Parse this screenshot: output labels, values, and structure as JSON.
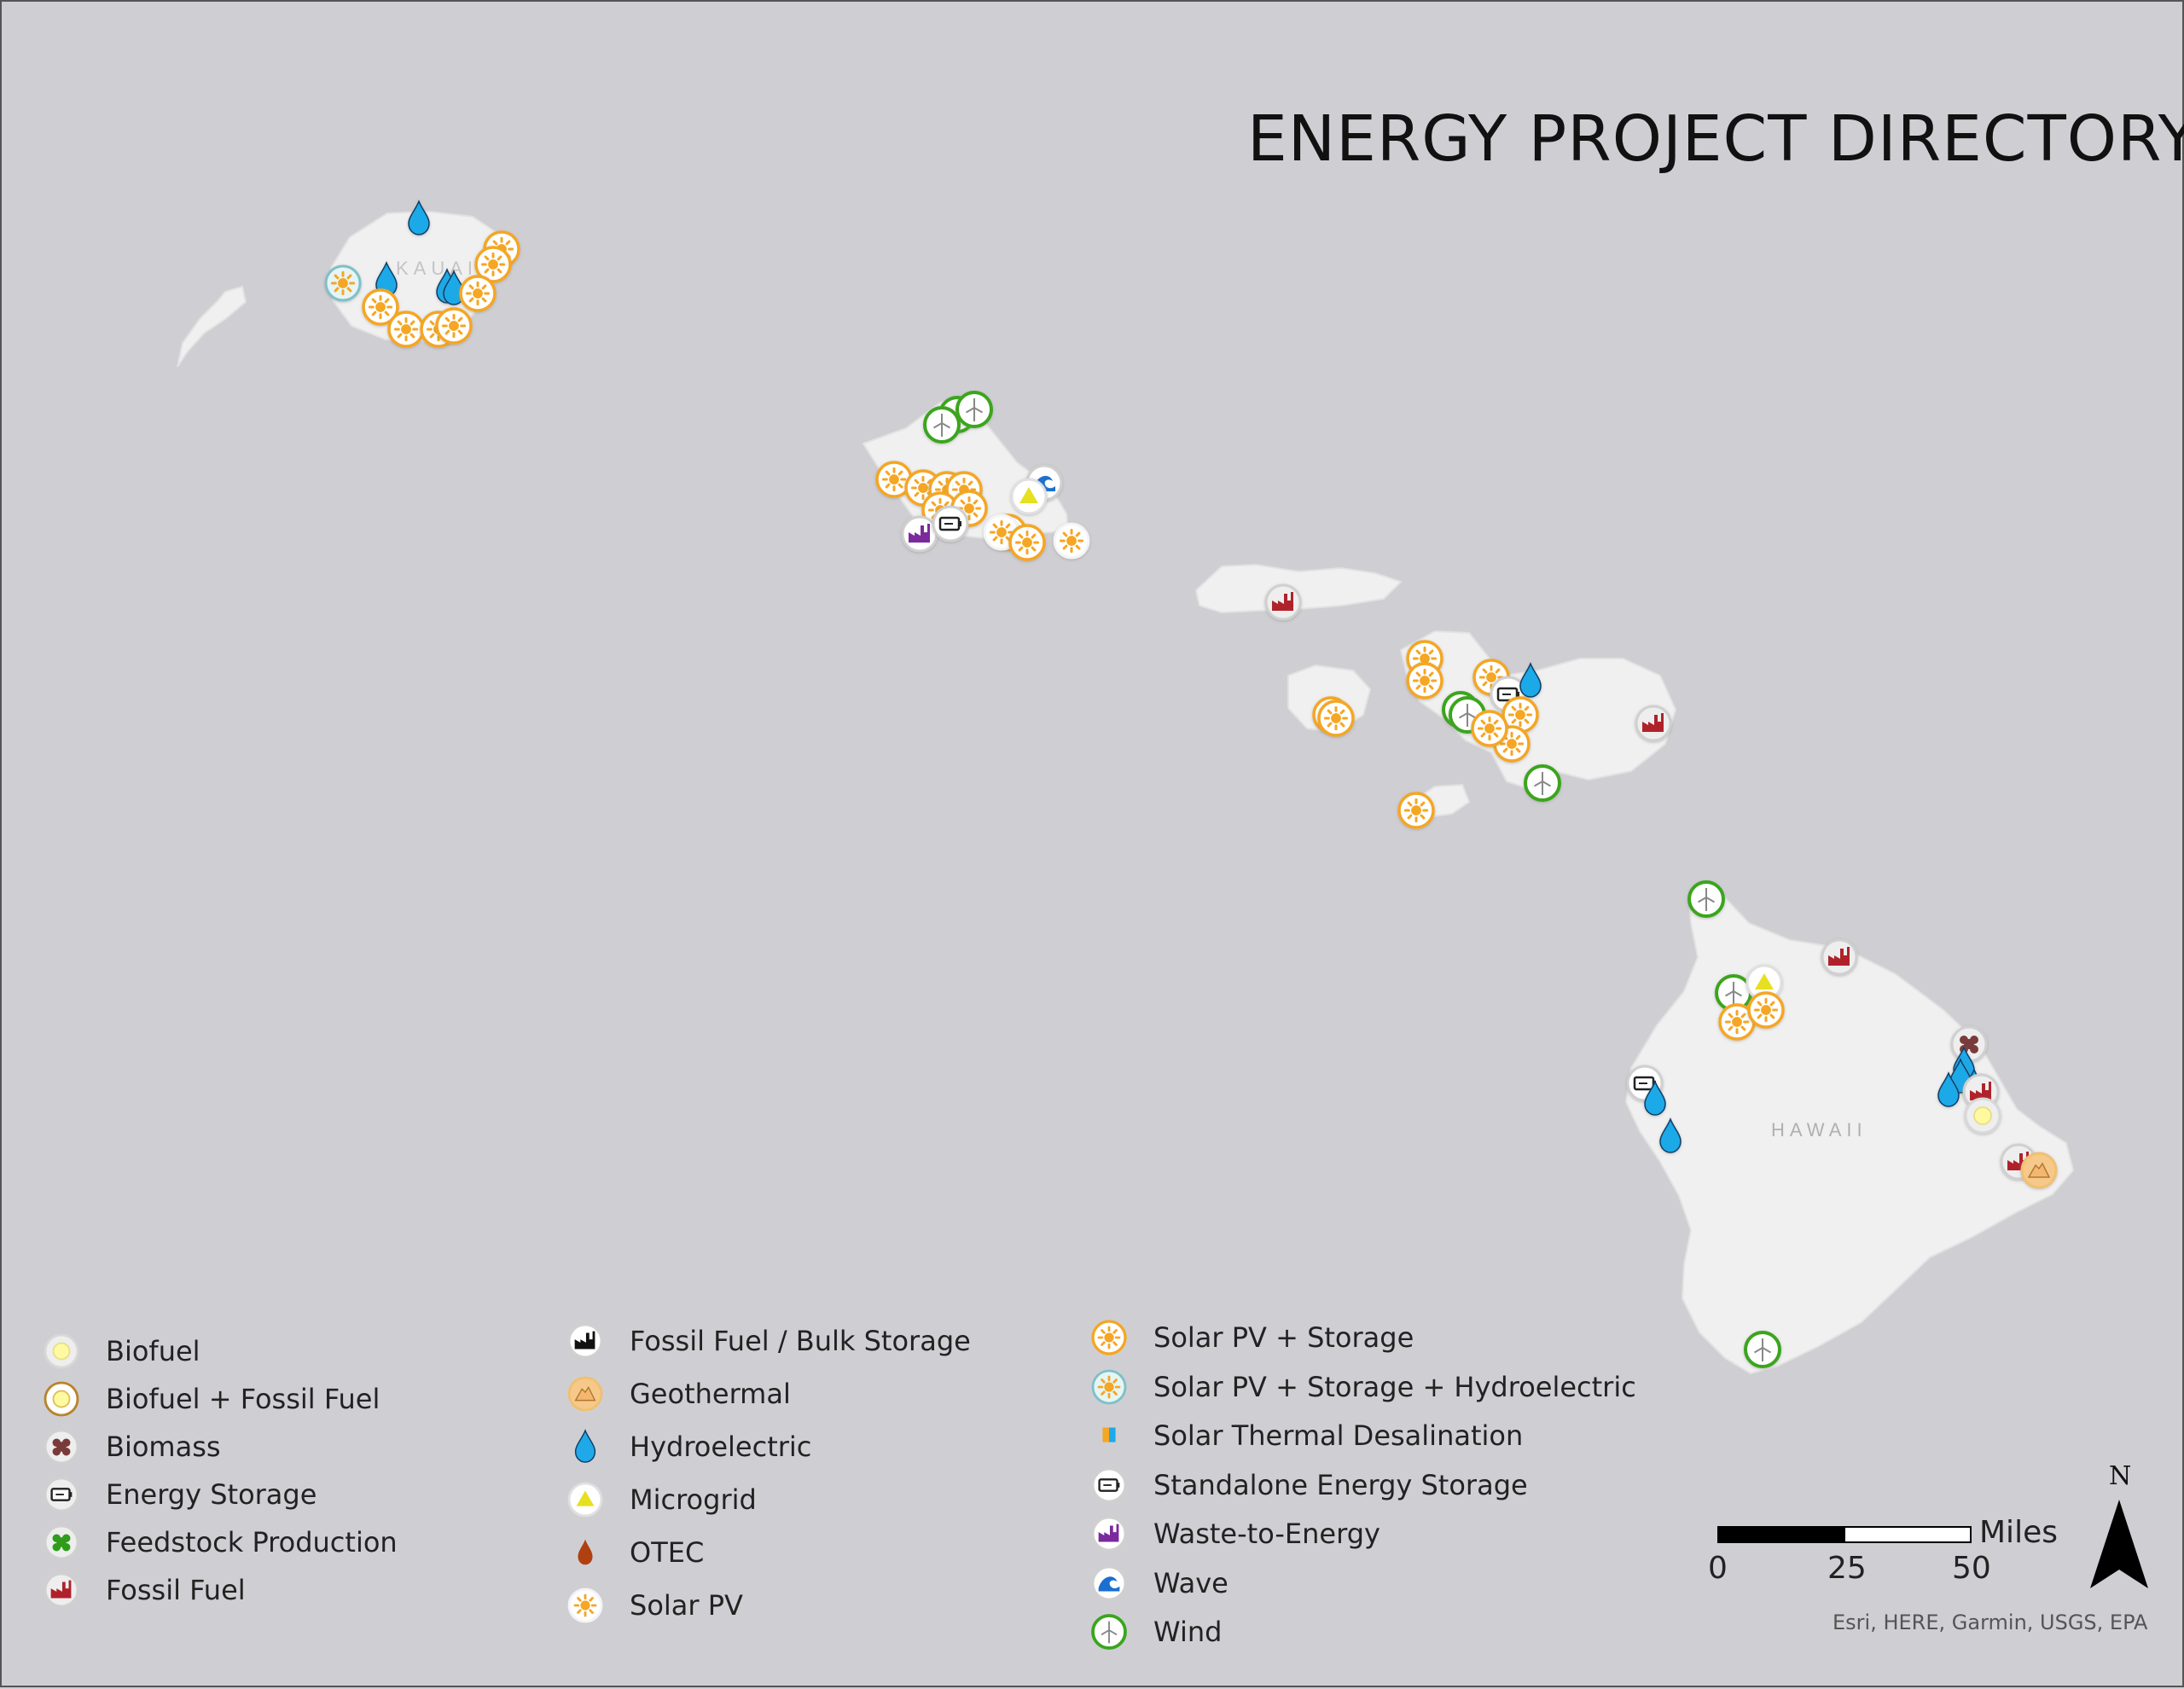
{
  "title": "ENERGY PROJECT DIRECTORY",
  "island_labels": {
    "kauai": "KAUAI",
    "hawaii": "HAWAII"
  },
  "legend": {
    "columns": [
      [
        {
          "icon": "biofuel",
          "label": "Biofuel"
        },
        {
          "icon": "biofuel-fossil",
          "label": "Biofuel + Fossil Fuel"
        },
        {
          "icon": "biomass",
          "label": "Biomass"
        },
        {
          "icon": "battery",
          "label": "Energy Storage"
        },
        {
          "icon": "feedstock",
          "label": "Feedstock Production"
        },
        {
          "icon": "fossil",
          "label": "Fossil Fuel"
        }
      ],
      [
        {
          "icon": "fossil-bulk",
          "label": "Fossil Fuel / Bulk Storage"
        },
        {
          "icon": "geothermal",
          "label": "Geothermal"
        },
        {
          "icon": "hydro",
          "label": "Hydroelectric"
        },
        {
          "icon": "microgrid",
          "label": "Microgrid"
        },
        {
          "icon": "otec",
          "label": "OTEC"
        },
        {
          "icon": "solar",
          "label": "Solar PV"
        }
      ],
      [
        {
          "icon": "solar-storage",
          "label": "Solar PV + Storage"
        },
        {
          "icon": "solar-hydro",
          "label": "Solar PV + Storage + Hydroelectric"
        },
        {
          "icon": "desal",
          "label": "Solar Thermal Desalination"
        },
        {
          "icon": "standalone",
          "label": "Standalone Energy Storage"
        },
        {
          "icon": "waste",
          "label": "Waste-to-Energy"
        },
        {
          "icon": "wave",
          "label": "Wave"
        },
        {
          "icon": "wind",
          "label": "Wind"
        }
      ]
    ]
  },
  "scale_bar": {
    "ticks": [
      "0",
      "25",
      "50"
    ],
    "unit": "Miles"
  },
  "north_label": "N",
  "attribution": "Esri, HERE, Garmin, USGS, EPA",
  "colors": {
    "ocean": "#cfcfd3",
    "land": "#f0f0f0",
    "solar": "#f5a623",
    "wind": "#3aa51e",
    "hydro": "#1fa9e8",
    "fossil": "#b0212b",
    "waste": "#7a2a9c"
  },
  "markers": [
    {
      "icon": "hydro"
    },
    {
      "icon": "solar-storage"
    },
    {
      "icon": "solar-hydro"
    },
    {
      "icon": "hydro"
    },
    {
      "icon": "hydro"
    },
    {
      "icon": "hydro"
    },
    {
      "icon": "solar-storage"
    },
    {
      "icon": "solar-storage"
    },
    {
      "icon": "solar-storage"
    },
    {
      "icon": "solar-storage"
    },
    {
      "icon": "solar-storage"
    },
    {
      "icon": "solar-storage"
    },
    {
      "icon": "wind"
    },
    {
      "icon": "wind"
    },
    {
      "icon": "wind"
    },
    {
      "icon": "solar-storage"
    },
    {
      "icon": "solar-storage"
    },
    {
      "icon": "solar-storage"
    },
    {
      "icon": "solar-storage"
    },
    {
      "icon": "solar-storage"
    },
    {
      "icon": "solar-storage"
    },
    {
      "icon": "solar-storage"
    },
    {
      "icon": "wave"
    },
    {
      "icon": "microgrid"
    },
    {
      "icon": "waste"
    },
    {
      "icon": "standalone"
    },
    {
      "icon": "solar"
    },
    {
      "icon": "solar-storage"
    },
    {
      "icon": "solar"
    },
    {
      "icon": "fossil"
    },
    {
      "icon": "solar-storage"
    },
    {
      "icon": "solar-storage"
    },
    {
      "icon": "solar-storage"
    },
    {
      "icon": "solar-storage"
    },
    {
      "icon": "wind"
    },
    {
      "icon": "wind"
    },
    {
      "icon": "standalone"
    },
    {
      "icon": "hydro"
    },
    {
      "icon": "solar-storage"
    },
    {
      "icon": "solar-storage"
    },
    {
      "icon": "solar-storage"
    },
    {
      "icon": "wind"
    },
    {
      "icon": "fossil"
    },
    {
      "icon": "solar-storage"
    },
    {
      "icon": "solar-storage"
    },
    {
      "icon": "wind"
    },
    {
      "icon": "fossil"
    },
    {
      "icon": "wind"
    },
    {
      "icon": "microgrid"
    },
    {
      "icon": "solar-storage"
    },
    {
      "icon": "solar-storage"
    },
    {
      "icon": "standalone"
    },
    {
      "icon": "hydro"
    },
    {
      "icon": "hydro"
    },
    {
      "icon": "biomass"
    },
    {
      "icon": "hydro"
    },
    {
      "icon": "hydro"
    },
    {
      "icon": "hydro"
    },
    {
      "icon": "hydro"
    },
    {
      "icon": "fossil"
    },
    {
      "icon": "biofuel"
    },
    {
      "icon": "fossil"
    },
    {
      "icon": "geothermal"
    },
    {
      "icon": "wind"
    }
  ]
}
